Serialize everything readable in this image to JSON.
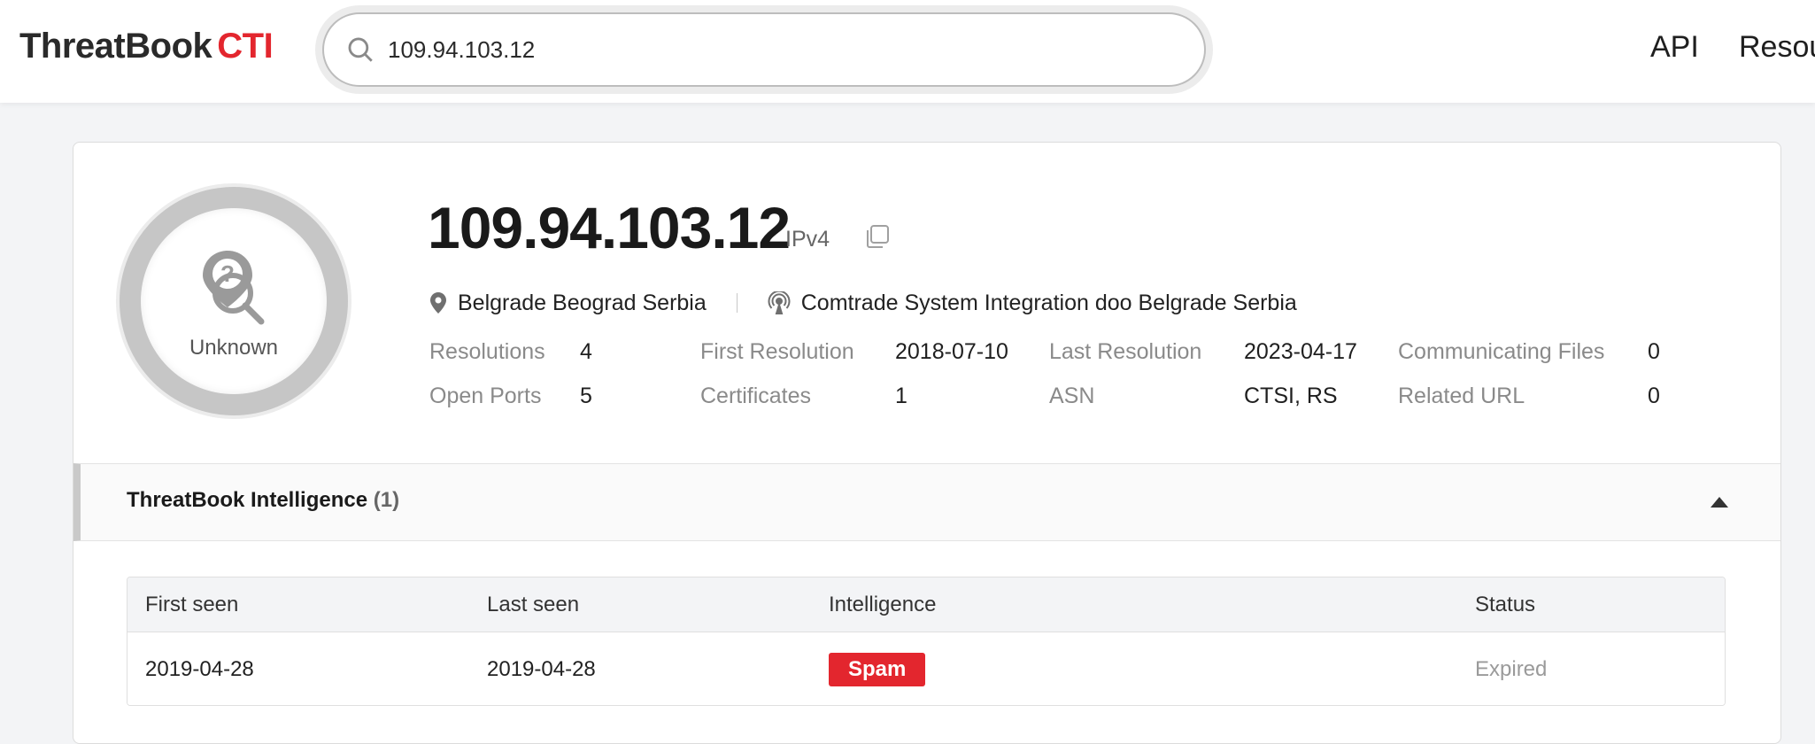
{
  "header": {
    "logo_main": "ThreatBook",
    "logo_accent": "CTI",
    "search_value": "109.94.103.12",
    "nav": [
      "API",
      "Resou"
    ]
  },
  "ip": {
    "address": "109.94.103.12",
    "type": "IPv4",
    "verdict": "Unknown",
    "location": "Belgrade Beograd Serbia",
    "isp": "Comtrade System Integration doo Belgrade Serbia"
  },
  "stats": [
    {
      "label": "Resolutions",
      "value": "4"
    },
    {
      "label": "First Resolution",
      "value": "2018-07-10"
    },
    {
      "label": "Last Resolution",
      "value": "2023-04-17"
    },
    {
      "label": "Communicating Files",
      "value": "0"
    },
    {
      "label": "Open Ports",
      "value": "5"
    },
    {
      "label": "Certificates",
      "value": "1"
    },
    {
      "label": "ASN",
      "value": "CTSI, RS"
    },
    {
      "label": "Related URL",
      "value": "0"
    }
  ],
  "intelligence": {
    "title": "ThreatBook Intelligence",
    "count": "(1)",
    "columns": [
      "First seen",
      "Last seen",
      "Intelligence",
      "Status"
    ],
    "rows": [
      {
        "first_seen": "2019-04-28",
        "last_seen": "2019-04-28",
        "intelligence": "Spam",
        "status": "Expired"
      }
    ]
  },
  "colors": {
    "brand_red": "#e3262e",
    "muted_text": "#8a8a8a"
  }
}
